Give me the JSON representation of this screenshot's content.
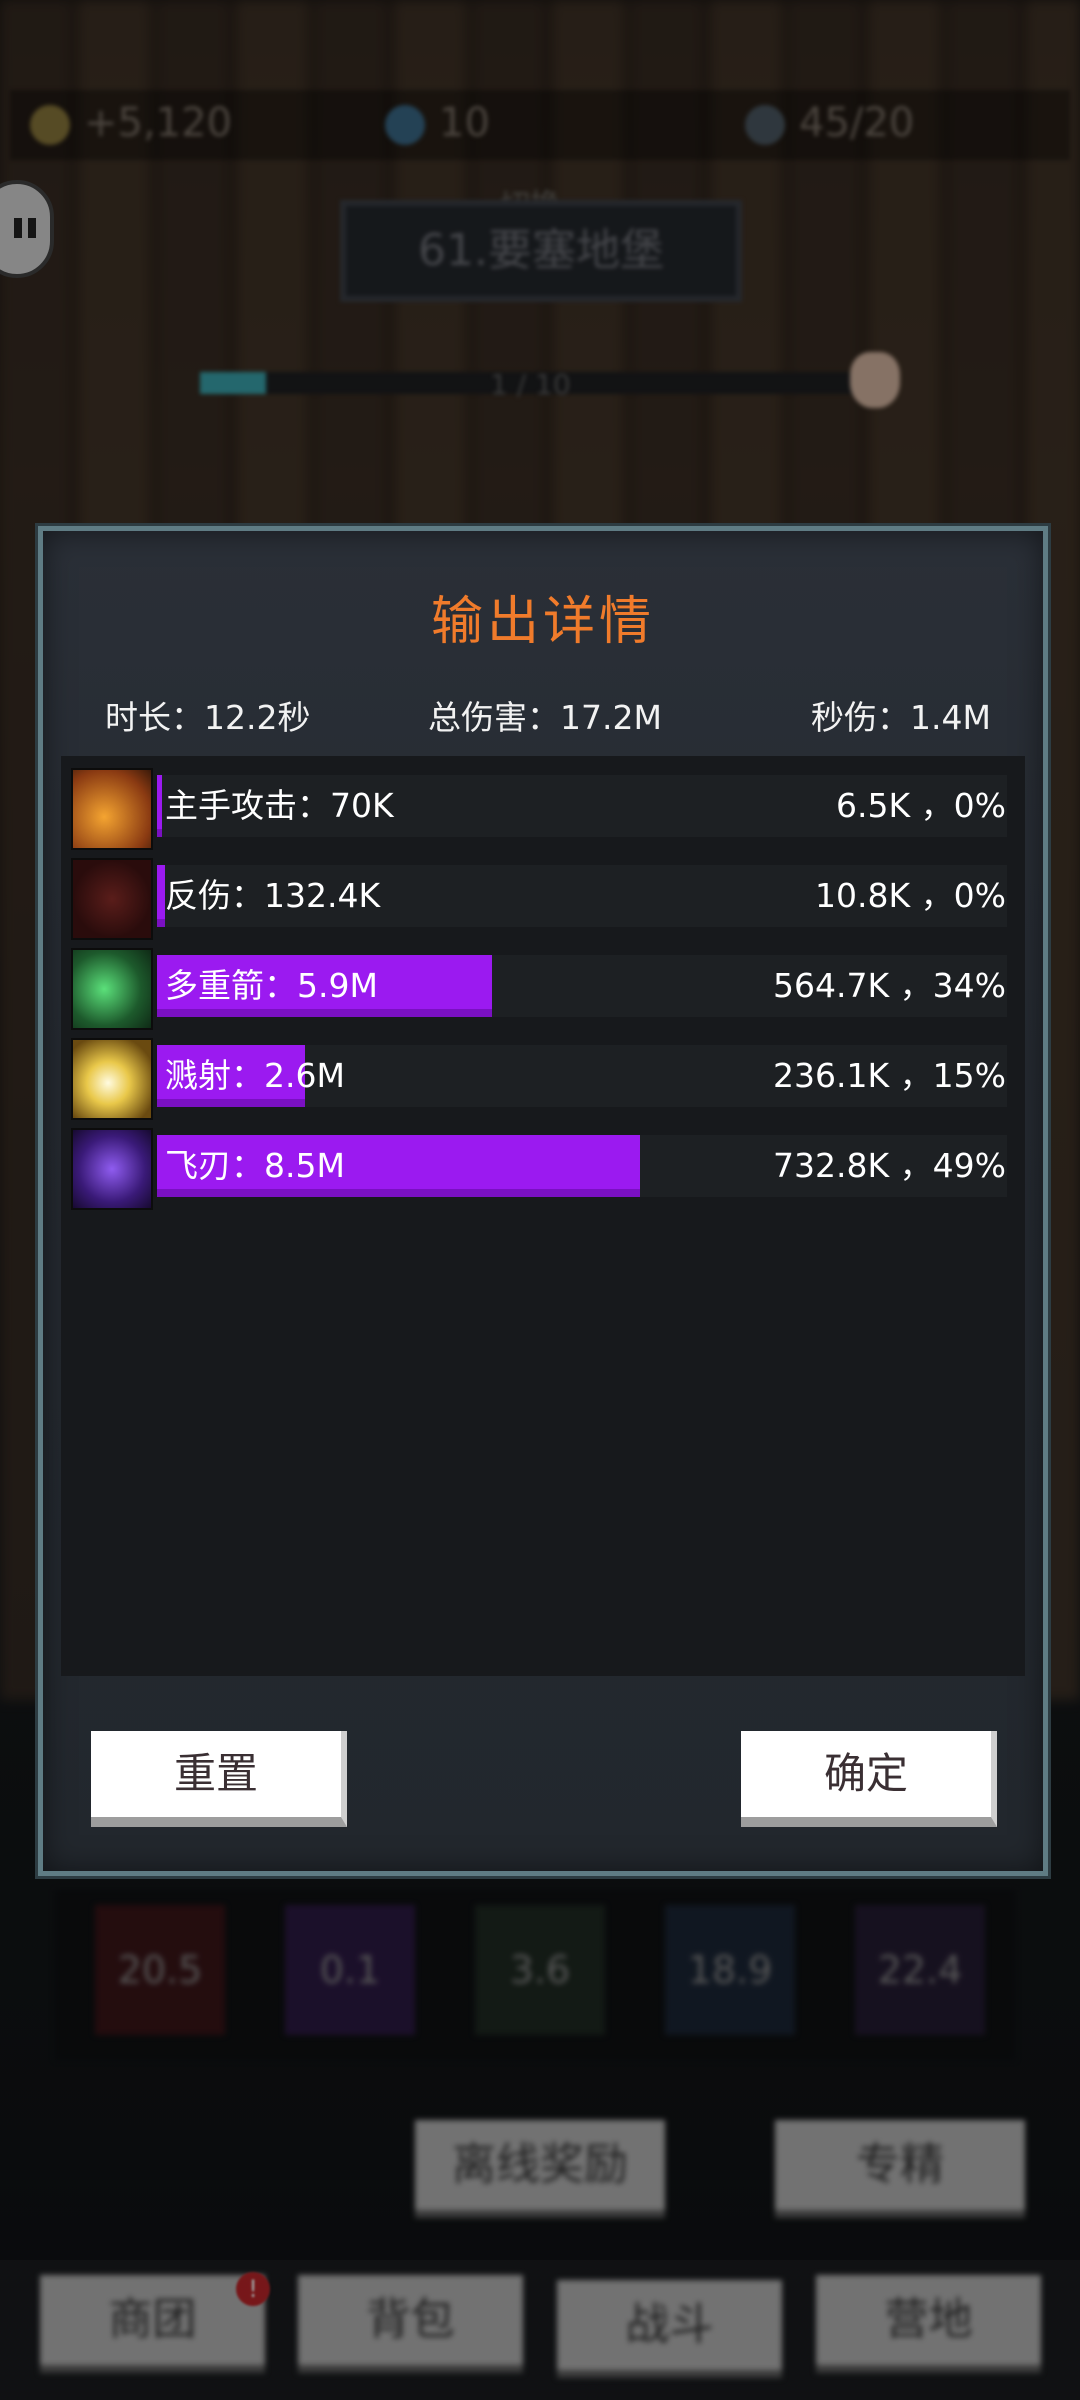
{
  "resources": {
    "gold": "+5,120",
    "gems": "10",
    "energy": "45/20"
  },
  "stage": {
    "switch_label": "切换",
    "name": "61.要塞地堡",
    "progress_text": "1 / 10",
    "progress_fraction": 0.1
  },
  "dialog": {
    "title": "输出详情",
    "duration_label": "时长：12.2秒",
    "total_damage_label": "总伤害：17.2M",
    "dps_label": "秒伤：1.4M",
    "rows": [
      {
        "name": "主手攻击：70K",
        "detail": "6.5K ，0%",
        "share": 0.005,
        "icon": "sword-icon"
      },
      {
        "name": "反伤：132.4K",
        "detail": "10.8K ，0%",
        "share": 0.008,
        "icon": "thorns-icon"
      },
      {
        "name": "多重箭：5.9M",
        "detail": "564.7K ，34%",
        "share": 0.34,
        "icon": "multishot-bow-icon"
      },
      {
        "name": "溅射：2.6M",
        "detail": "236.1K ，15%",
        "share": 0.15,
        "icon": "splash-burst-icon"
      },
      {
        "name": "飞刃：8.5M",
        "detail": "732.8K ，49%",
        "share": 0.49,
        "icon": "flying-blade-icon"
      }
    ],
    "reset_label": "重置",
    "confirm_label": "确定"
  },
  "stats": [
    "20.5",
    "0.1",
    "3.6",
    "18.9",
    "22.4"
  ],
  "actions": {
    "offline_reward": "离线奖励",
    "specialize": "专精"
  },
  "nav": {
    "items": [
      "商团",
      "背包",
      "战斗",
      "营地"
    ],
    "badge": "!"
  },
  "colors": {
    "title": "#f07b2b",
    "bar": "#9b1af0",
    "dialog_border": "#5f7c84"
  }
}
